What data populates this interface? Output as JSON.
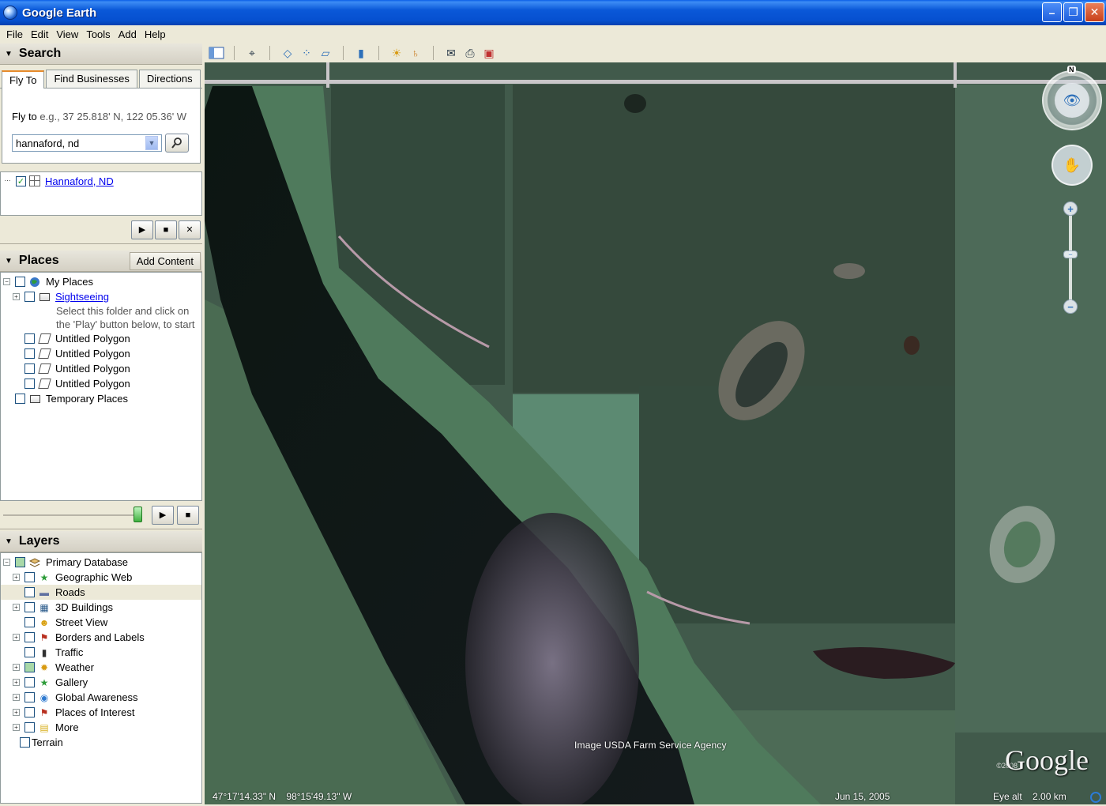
{
  "window": {
    "title": "Google Earth",
    "minimize": "–",
    "maximize": "❐",
    "close": "✕"
  },
  "menu": [
    "File",
    "Edit",
    "View",
    "Tools",
    "Add",
    "Help"
  ],
  "search": {
    "header": "Search",
    "tabs": [
      "Fly To",
      "Find Businesses",
      "Directions"
    ],
    "flyto_label": "Fly to",
    "flyto_hint": "e.g., 37 25.818' N, 122 05.36' W",
    "input_value": "hannaford, nd",
    "result": "Hannaford, ND"
  },
  "places": {
    "header": "Places",
    "add_content": "Add Content",
    "items": {
      "my_places": "My Places",
      "sightseeing": "Sightseeing",
      "sightseeing_desc": "Select this folder and click on the 'Play' button below, to start",
      "polygons": [
        "Untitled Polygon",
        "Untitled Polygon",
        "Untitled Polygon",
        "Untitled Polygon"
      ],
      "temporary": "Temporary Places"
    }
  },
  "layers": {
    "header": "Layers",
    "primary": "Primary Database",
    "items": [
      {
        "label": "Geographic Web",
        "icon": "star-icon",
        "expandable": true
      },
      {
        "label": "Roads",
        "icon": "road-icon",
        "expandable": false
      },
      {
        "label": "3D Buildings",
        "icon": "building-icon",
        "expandable": true
      },
      {
        "label": "Street View",
        "icon": "person-icon",
        "expandable": false
      },
      {
        "label": "Borders and Labels",
        "icon": "flag-icon",
        "expandable": true
      },
      {
        "label": "Traffic",
        "icon": "traffic-light-icon",
        "expandable": false
      },
      {
        "label": "Weather",
        "icon": "sun-icon",
        "expandable": true
      },
      {
        "label": "Gallery",
        "icon": "star-icon",
        "expandable": true
      },
      {
        "label": "Global Awareness",
        "icon": "globe-icon",
        "expandable": true
      },
      {
        "label": "Places of Interest",
        "icon": "flag-icon",
        "expandable": true
      },
      {
        "label": "More",
        "icon": "note-icon",
        "expandable": true
      }
    ],
    "terrain": "Terrain"
  },
  "map": {
    "attribution": "Image USDA Farm Service Agency",
    "logo": "Google",
    "copyright": "©2008",
    "coords": "47°17'14.33\" N    98°15'49.13\" W",
    "date": "Jun 15, 2005",
    "eye_alt_label": "Eye alt",
    "eye_alt_value": "2.00 km",
    "north": "N"
  }
}
